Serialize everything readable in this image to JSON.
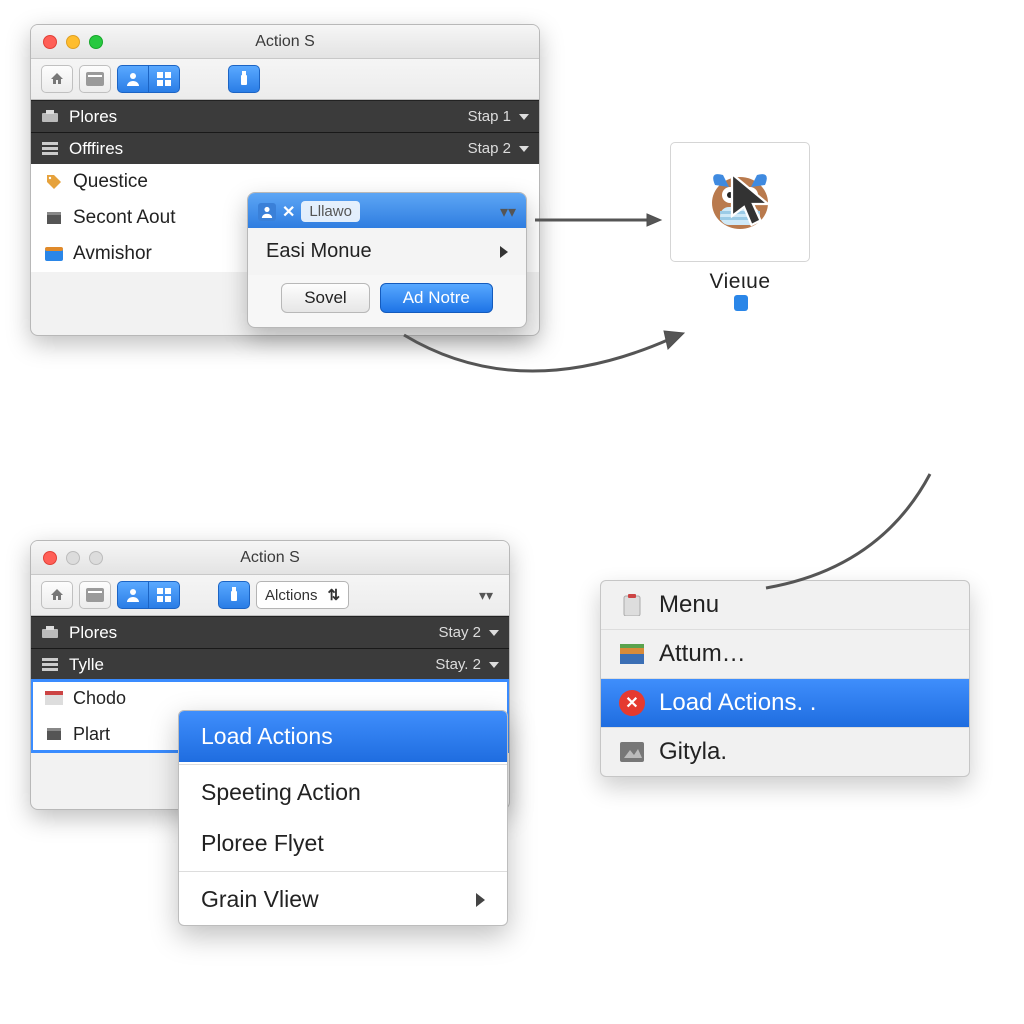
{
  "window1": {
    "title": "Action S",
    "headers": [
      {
        "name": "Plores",
        "right": "Stap 1"
      },
      {
        "name": "Offfires",
        "right": "Stap 2"
      }
    ],
    "rows": [
      "Questice",
      "Secont Aout",
      "Avmishor"
    ],
    "popover": {
      "chip_label": "Lllawo",
      "menu_label": "Easi Monue",
      "cancel": "Sovel",
      "confirm": "Ad Notre"
    }
  },
  "file": {
    "label": "Vieιue"
  },
  "window2": {
    "title": "Action S",
    "toolbar_field": "Alctions",
    "headers": [
      {
        "name": "Plores",
        "right": "Stay 2"
      },
      {
        "name": "Tylle",
        "right": "Stay. 2"
      }
    ],
    "rows": [
      "Chodo",
      "Plart"
    ],
    "context": {
      "items": [
        {
          "label": "Load Actions",
          "selected": true,
          "submenu": false
        },
        {
          "label": "Speeting Action",
          "selected": false,
          "submenu": false
        },
        {
          "label": "Ploree Flyet",
          "selected": false,
          "submenu": false
        },
        {
          "label": "Grain Vliew",
          "selected": false,
          "submenu": true
        }
      ]
    }
  },
  "ctxlist": {
    "items": [
      {
        "label": "Menu"
      },
      {
        "label": "Attum…"
      },
      {
        "label": "Load Actions. .",
        "selected": true,
        "close_icon": true
      },
      {
        "label": "Gityla."
      }
    ]
  }
}
